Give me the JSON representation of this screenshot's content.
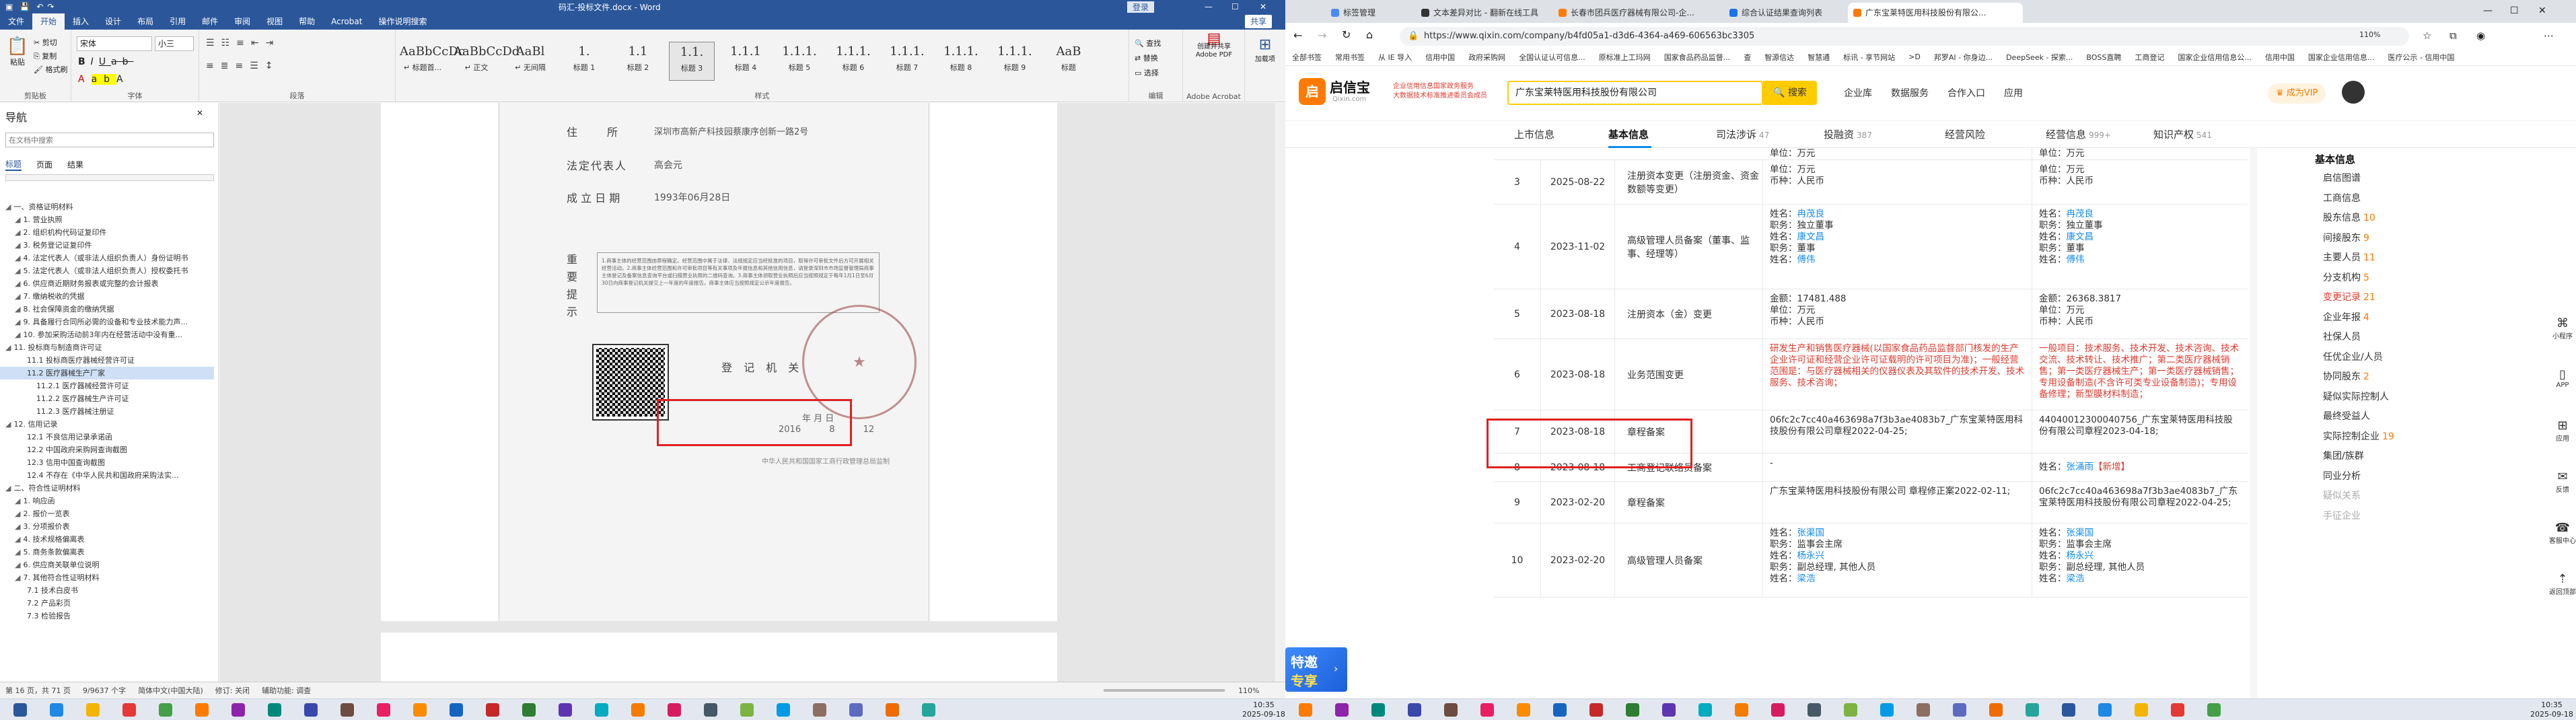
{
  "word": {
    "title": "码汇-投标文件.docx - Word",
    "title_right": "登录",
    "tabs": [
      "文件",
      "开始",
      "插入",
      "设计",
      "布局",
      "引用",
      "邮件",
      "审阅",
      "视图",
      "帮助",
      "Acrobat",
      "操作说明搜索"
    ],
    "share": "共享",
    "clipboard": {
      "paste": "粘贴",
      "cut": "剪切",
      "copy": "复制",
      "painter": "格式刷",
      "label": "剪贴板"
    },
    "font": {
      "name": "宋体",
      "size": "小三",
      "label": "字体"
    },
    "paragraph_label": "段落",
    "styles_label": "样式",
    "styles": [
      {
        "preview": "AaBbCcDc",
        "name": "↵ 标题首..."
      },
      {
        "preview": "AaBbCcDd",
        "name": "↵ 正文"
      },
      {
        "preview": "AaBl",
        "name": "↵ 无间隔"
      },
      {
        "preview": "1.",
        "name": "标题 1"
      },
      {
        "preview": "1.1",
        "name": "标题 2"
      },
      {
        "preview": "1.1.",
        "name": "标题 3"
      },
      {
        "preview": "1.1.1",
        "name": "标题 4"
      },
      {
        "preview": "1.1.1.",
        "name": "标题 5"
      },
      {
        "preview": "1.1.1.",
        "name": "标题 6"
      },
      {
        "preview": "1.1.1.",
        "name": "标题 7"
      },
      {
        "preview": "1.1.1.",
        "name": "标题 8"
      },
      {
        "preview": "1.1.1.",
        "name": "标题 9"
      },
      {
        "preview": "AaB",
        "name": "标题"
      }
    ],
    "editing": {
      "find": "查找",
      "replace": "替换",
      "select": "选择",
      "label": "编辑"
    },
    "acrobat": {
      "create": "创建并共享 Adobe PDF",
      "req": "请求签名",
      "label": "Adobe Acrobat"
    },
    "addon": {
      "name": "加载项",
      "label": "加载项"
    },
    "nav": {
      "title": "导航",
      "search_placeholder": "在文档中搜索",
      "tabs": [
        "标题",
        "页面",
        "结果"
      ],
      "items": [
        {
          "t": "一、资格证明材料",
          "lv": 0
        },
        {
          "t": "1. 营业执照",
          "lv": 1
        },
        {
          "t": "2. 组织机构代码证复印件",
          "lv": 1
        },
        {
          "t": "3. 税务登记证复印件",
          "lv": 1
        },
        {
          "t": "4. 法定代表人（或非法人组织负责人）身份证明书",
          "lv": 1
        },
        {
          "t": "5. 法定代表人（或非法人组织负责人）授权委托书",
          "lv": 1
        },
        {
          "t": "6. 供应商近期财务报表或完整的会计报表",
          "lv": 1
        },
        {
          "t": "7. 缴纳税收的凭据",
          "lv": 1
        },
        {
          "t": "8. 社会保障资金的缴纳凭据",
          "lv": 1
        },
        {
          "t": "9. 具备履行合同所必需的设备和专业技术能力声...",
          "lv": 1
        },
        {
          "t": "10. 参加采购活动前3年内在经营活动中没有重...",
          "lv": 1
        },
        {
          "t": "11. 投标商与制造商许可证",
          "lv": 0
        },
        {
          "t": "11.1 投标商医疗器械经营许可证",
          "lv": 2
        },
        {
          "t": "11.2 医疗器械生产厂家",
          "lv": 2,
          "sel": true
        },
        {
          "t": "11.2.1 医疗器械经营许可证",
          "lv": 3
        },
        {
          "t": "11.2.2 医疗器械生产许可证",
          "lv": 3
        },
        {
          "t": "11.2.3 医疗器械注册证",
          "lv": 3
        },
        {
          "t": "12. 信用记录",
          "lv": 0
        },
        {
          "t": "12.1 不良信用记录承诺函",
          "lv": 2
        },
        {
          "t": "12.2 中国政府采购网查询截图",
          "lv": 2
        },
        {
          "t": "12.3 信用中国查询截图",
          "lv": 2
        },
        {
          "t": "12.4 不存在《中华人民共和国政府采购法实...",
          "lv": 2
        },
        {
          "t": "二、符合性证明材料",
          "lv": 0
        },
        {
          "t": "1. 响应函",
          "lv": 1
        },
        {
          "t": "2. 报价一览表",
          "lv": 1
        },
        {
          "t": "3. 分项报价表",
          "lv": 1
        },
        {
          "t": "4. 技术规格偏离表",
          "lv": 1
        },
        {
          "t": "5. 商务条款偏离表",
          "lv": 1
        },
        {
          "t": "6. 供应商关联单位说明",
          "lv": 1
        },
        {
          "t": "7. 其他符合性证明材料",
          "lv": 1
        },
        {
          "t": "7.1 技术白皮书",
          "lv": 2
        },
        {
          "t": "7.2 产品彩页",
          "lv": 2
        },
        {
          "t": "7.3 检验报告",
          "lv": 2
        }
      ]
    },
    "doc": {
      "addr_label": "住　　所",
      "addr_value": "深圳市高新产科技园蔡康序创新一路2号",
      "legal_label": "法定代表人",
      "legal_value": "高会元",
      "date_label": "成 立 日 期",
      "date_value": "1993年06月28日",
      "notice_label": "重要提示",
      "notice": "1.商事主体的经营范围由章程确定。经营范围中属于法律、法规规定应当经批准的项目，取得许可审批文件后方可开展相关经营活动。2.商事主体经营范围和许可审批项目等有关事项及年报信息和其他信用信息，请登录深圳市市场监督管理局商事主体登记及备案信息查询平台或扫描营业执照的二维码查询。3.商事主体领取营业执照后应当按照规定于每年1月1日至6月30日向商事登记机关提交上一年度的年度报告。商事主体应当按照规定公示年度报告。",
      "reg_label": "登 记 机 关",
      "year": "2016",
      "month": "8",
      "day": "12",
      "ymd_suffix": "年   月   日",
      "footer": "中华人民共和国国家工商行政管理总局监制"
    },
    "status": {
      "page": "第 16 页，共 71 页",
      "words": "9/9637 个字",
      "lang": "简体中文(中国大陆)",
      "track": "修订: 关闭",
      "access": "辅助功能: 调查",
      "zoom": "110%"
    }
  },
  "browser": {
    "tabs": [
      {
        "label": "标签管理",
        "color": "#4c8bf5"
      },
      {
        "label": "文本差异对比 - 翻新在线工具",
        "color": "#333"
      },
      {
        "label": "长春市团兵医疗器械有限公司-企...",
        "color": "#ff7a00"
      },
      {
        "label": "综合认证结果查询列表",
        "color": "#1a73e8"
      },
      {
        "label": "广东宝莱特医用科技股份有限公...",
        "color": "#ff7a00",
        "on": true
      }
    ],
    "url": "https://www.qixin.com/company/b4fd05a1-d3d6-4364-a469-606563bc3305",
    "zoom": "110%",
    "bookmarks": [
      "全部书签",
      "常用书签",
      "从 IE 导入",
      "信用中国",
      "政府采购网",
      "全国认证认可信息...",
      "原标准上工玛网",
      "国家食品药品监督...",
      "查",
      "智源信达",
      "智慧通",
      "标讯 - 享节网站",
      ">D",
      "邦罗AI - 你身边...",
      "DeepSeek - 探索...",
      "BOSS直聘",
      "工商登记",
      "国家企业信用信息公...",
      "信用中国",
      "国家企业信用信息...",
      "医疗公示 - 信用中国"
    ],
    "qx": {
      "logo": "启信宝",
      "logo_sub": "Qixin.com",
      "badge1": "企业信用信息国家政务服务",
      "badge2": "大数据技术标准推进委员会成员",
      "search_value": "广东宝莱特医用科技股份有限公司",
      "search_btn": "搜索",
      "menu": [
        "企业库",
        "数据服务",
        "合作入口",
        "应用"
      ],
      "vip": "成为VIP"
    },
    "qtabs": [
      {
        "label": "上市信息",
        "n": ""
      },
      {
        "label": "基本信息",
        "n": "",
        "on": true
      },
      {
        "label": "司法涉诉",
        "n": "47"
      },
      {
        "label": "投融资",
        "n": "387"
      },
      {
        "label": "经营风险",
        "n": ""
      },
      {
        "label": "经营信息",
        "n": "999+"
      },
      {
        "label": "知识产权",
        "n": "541"
      }
    ],
    "rows": [
      {
        "idx": "3",
        "date": "2025-08-22",
        "item": "注册资本变更（注册资金、资金数额等变更）",
        "before": "单位：万元\n币种：人民币",
        "after": "单位：万元\n币种：人民币"
      },
      {
        "idx": "4",
        "date": "2023-11-02",
        "item": "高级管理人员备案（董事、监事、经理等）",
        "before_l": [
          [
            "姓名：",
            "冉茂良"
          ],
          [
            "职务：",
            "独立董事"
          ],
          [
            "姓名：",
            "康文昌"
          ],
          [
            "职务：",
            "董事"
          ],
          [
            "姓名：",
            "傅伟"
          ]
        ],
        "after_l": [
          [
            "姓名：",
            "冉茂良"
          ],
          [
            "职务：",
            "独立董事"
          ],
          [
            "姓名：",
            "康文昌"
          ],
          [
            "职务：",
            "董事"
          ],
          [
            "姓名：",
            "傅伟"
          ]
        ]
      },
      {
        "idx": "5",
        "date": "2023-08-18",
        "item": "注册资本（金）变更",
        "before": "金额：17481.488\n单位：万元\n币种：人民币",
        "after": "金额：26368.3817\n单位：万元\n币种：人民币"
      },
      {
        "idx": "6",
        "date": "2023-08-18",
        "item": "业务范围变更",
        "before": "研发生产和销售医疗器械(以国家食品药品监督部门核发的生产企业许可证和经营企业许可证载明的许可项目为准)；一般经营范围是：与医疗器械相关的仪器仪表及其软件的技术开发、技术服务、技术咨询；",
        "after": "一般项目：技术服务、技术开发、技术咨询、技术交流、技术转让、技术推广；第二类医疗器械销售；第一类医疗器械生产；第一类医疗器械销售；专用设备制造(不含许可类专业设备制造)；专用设备修理；新型膜材料制造；"
      },
      {
        "idx": "7",
        "date": "2023-08-18",
        "item": "章程备案",
        "before": "06fc2c7cc40a463698a7f3b3ae4083b7_广东宝莱特医用科技股份有限公司章程2022-04-25;",
        "after": "44040012300040756_广东宝莱特医用科技股份有限公司章程2023-04-18;"
      },
      {
        "idx": "8",
        "date": "2023-08-18",
        "item": "工商登记联络员备案",
        "before": "-",
        "after_name": "张涌雨",
        "after_tag": "【新增】",
        "after_pre": "姓名："
      },
      {
        "idx": "9",
        "date": "2023-02-20",
        "item": "章程备案",
        "before": "广东宝莱特医用科技股份有限公司 章程修正案2022-02-11;",
        "after": "06fc2c7cc40a463698a7f3b3ae4083b7_广东宝莱特医用科技股份有限公司章程2022-04-25;"
      },
      {
        "idx": "10",
        "date": "2023-02-20",
        "item": "高级管理人员备案",
        "before_l": [
          [
            "姓名：",
            "张渠国"
          ],
          [
            "职务：",
            "监事会主席"
          ],
          [
            "姓名：",
            "杨永兴"
          ],
          [
            "职务：",
            "副总经理, 其他人员"
          ],
          [
            "姓名：",
            "梁浩"
          ]
        ],
        "after_l": [
          [
            "姓名：",
            "张渠国"
          ],
          [
            "职务：",
            "监事会主席"
          ],
          [
            "姓名：",
            "杨永兴"
          ],
          [
            "职务：",
            "副总经理, 其他人员"
          ],
          [
            "姓名：",
            "梁浩"
          ]
        ]
      }
    ],
    "top_cut": {
      "before": "单位：万元",
      "after": "单位：万元"
    },
    "side": {
      "title": "基本信息",
      "items": [
        {
          "t": "启信图谱",
          "n": ""
        },
        {
          "t": "工商信息",
          "n": ""
        },
        {
          "t": "股东信息",
          "n": "10"
        },
        {
          "t": "间接股东",
          "n": "9"
        },
        {
          "t": "主要人员",
          "n": "11"
        },
        {
          "t": "分支机构",
          "n": "5"
        },
        {
          "t": "变更记录",
          "n": "21",
          "hl": true
        },
        {
          "t": "企业年报",
          "n": "4"
        },
        {
          "t": "社保人员",
          "n": ""
        },
        {
          "t": "任优企业/人员",
          "n": ""
        },
        {
          "t": "协同股东",
          "n": "2"
        },
        {
          "t": "疑似实际控制人",
          "n": ""
        },
        {
          "t": "最终受益人",
          "n": ""
        },
        {
          "t": "实际控制企业",
          "n": "19"
        },
        {
          "t": "集团/族群",
          "n": ""
        },
        {
          "t": "同业分析",
          "n": ""
        },
        {
          "t": "疑似关系",
          "n": "",
          "dis": true
        },
        {
          "t": "手征企业",
          "n": "",
          "dis": true
        }
      ]
    },
    "edge_side": [
      "小程序",
      "APP",
      "应用",
      "反馈",
      "客服中心",
      "返回顶部"
    ],
    "promo": {
      "l1": "特邀",
      "l2": "专享"
    }
  },
  "taskbar": {
    "time": "10:35",
    "date": "2025-09-18",
    "time2": "10:35",
    "date2": "2025-09-18"
  },
  "colors": {
    "word_blue": "#2b579a",
    "qixin_blue": "#128bed",
    "qixin_orange": "#ff7a00",
    "highlight_red": "#e02020"
  }
}
